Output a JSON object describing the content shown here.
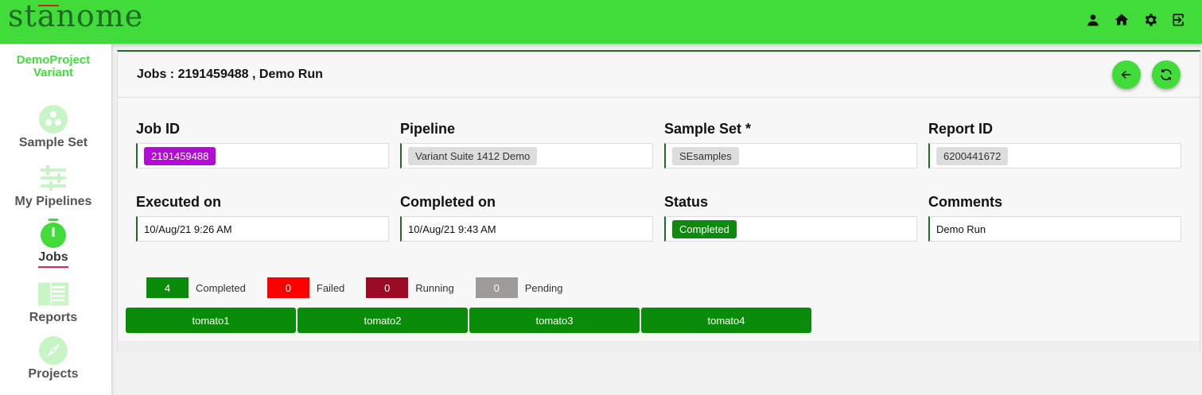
{
  "app": {
    "logo_text": "stanome"
  },
  "topbar": {
    "icons": [
      "person-icon",
      "home-icon",
      "gear-icon",
      "logout-icon"
    ]
  },
  "sidebar": {
    "project_line1": "DemoProject",
    "project_line2": "Variant",
    "items": [
      {
        "label": "Sample Set",
        "icon": "sample-set-icon",
        "active": false
      },
      {
        "label": "My Pipelines",
        "icon": "sliders-icon",
        "active": false
      },
      {
        "label": "Jobs",
        "icon": "stopwatch-icon",
        "active": true
      },
      {
        "label": "Reports",
        "icon": "report-icon",
        "active": false
      },
      {
        "label": "Projects",
        "icon": "compass-icon",
        "active": false
      }
    ]
  },
  "panel": {
    "title": "Jobs : 2191459488 , Demo Run",
    "fields": {
      "job_id": {
        "label": "Job ID",
        "value": "2191459488"
      },
      "pipeline": {
        "label": "Pipeline",
        "value": "Variant Suite 1412 Demo"
      },
      "sample_set": {
        "label": "Sample Set *",
        "value": "SEsamples"
      },
      "report_id": {
        "label": "Report ID",
        "value": "6200441672"
      },
      "executed_on": {
        "label": "Executed on",
        "value": "10/Aug/21 9:26 AM"
      },
      "completed_on": {
        "label": "Completed on",
        "value": "10/Aug/21 9:43 AM"
      },
      "status": {
        "label": "Status",
        "value": "Completed"
      },
      "comments": {
        "label": "Comments",
        "value": "Demo Run"
      }
    },
    "legend": {
      "completed": {
        "count": "4",
        "label": "Completed",
        "color": "#0a8c0a"
      },
      "failed": {
        "count": "0",
        "label": "Failed",
        "color": "#ff0000"
      },
      "running": {
        "count": "0",
        "label": "Running",
        "color": "#9b0b26"
      },
      "pending": {
        "count": "0",
        "label": "Pending",
        "color": "#9e9a9a"
      }
    },
    "samples": [
      "tomato1",
      "tomato2",
      "tomato3",
      "tomato4"
    ]
  },
  "colors": {
    "topbar": "#42dc3a",
    "accent_dark": "#1f6b26",
    "sample_green": "#0a8c0a",
    "job_chip": "#b40bd6"
  }
}
